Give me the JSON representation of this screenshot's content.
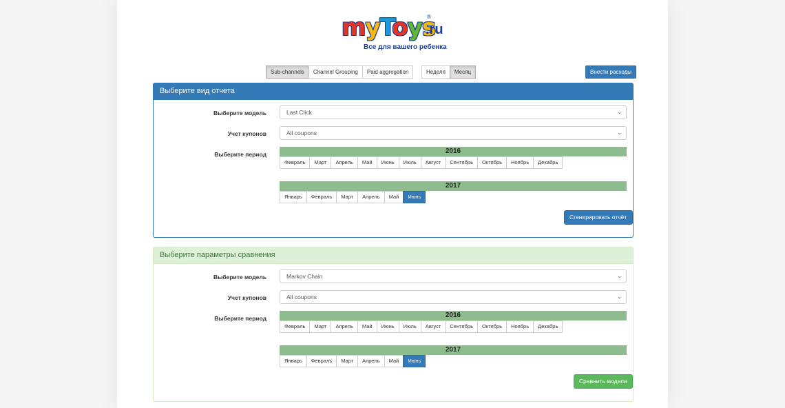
{
  "logo": {
    "brand": "myToys",
    "tld": ".ru",
    "reg": "®",
    "tagline": "Все для вашего ребенка"
  },
  "toolbar": {
    "group1": [
      "Sub-channels",
      "Channel Grouping",
      "Paid aggregation"
    ],
    "group1_active": 0,
    "group2": [
      "Неделя",
      "Месяц"
    ],
    "group2_active": 1,
    "expenses_button": "Внести расходы"
  },
  "report_panel": {
    "title": "Выберите вид отчета",
    "model_label": "Выберите модель",
    "model_value": "Last Click",
    "coupons_label": "Учет купонов",
    "coupons_value": "All coupons",
    "period_label": "Выберите период",
    "year1": "2016",
    "months1": [
      "Февраль",
      "Март",
      "Апрель",
      "Май",
      "Июнь",
      "Июль",
      "Август",
      "Сентябрь",
      "Октябрь",
      "Ноябрь",
      "Декабрь"
    ],
    "year2": "2017",
    "months2": [
      "Январь",
      "Февраль",
      "Март",
      "Апрель",
      "Май",
      "Июнь"
    ],
    "selected_month2": "Июнь",
    "action_button": "Сгенерировать отчёт"
  },
  "compare_panel": {
    "title": "Выберите параметры сравнения",
    "model_label": "Выберите модель",
    "model_value": "Markov Chain",
    "coupons_label": "Учет купонов",
    "coupons_value": "All coupons",
    "period_label": "Выберите период",
    "year1": "2016",
    "months1": [
      "Февраль",
      "Март",
      "Апрель",
      "Май",
      "Июнь",
      "Июль",
      "Август",
      "Сентябрь",
      "Октябрь",
      "Ноябрь",
      "Декабрь"
    ],
    "year2": "2017",
    "months2": [
      "Январь",
      "Февраль",
      "Март",
      "Апрель",
      "Май",
      "Июнь"
    ],
    "selected_month2": "Июнь",
    "action_button": "Сравнить модели"
  },
  "icons": {
    "dropdown": "chevron-down-icon"
  },
  "colors": {
    "primary": "#337ab7",
    "success": "#5cb85c",
    "year_bar": "#8fbc8f"
  }
}
